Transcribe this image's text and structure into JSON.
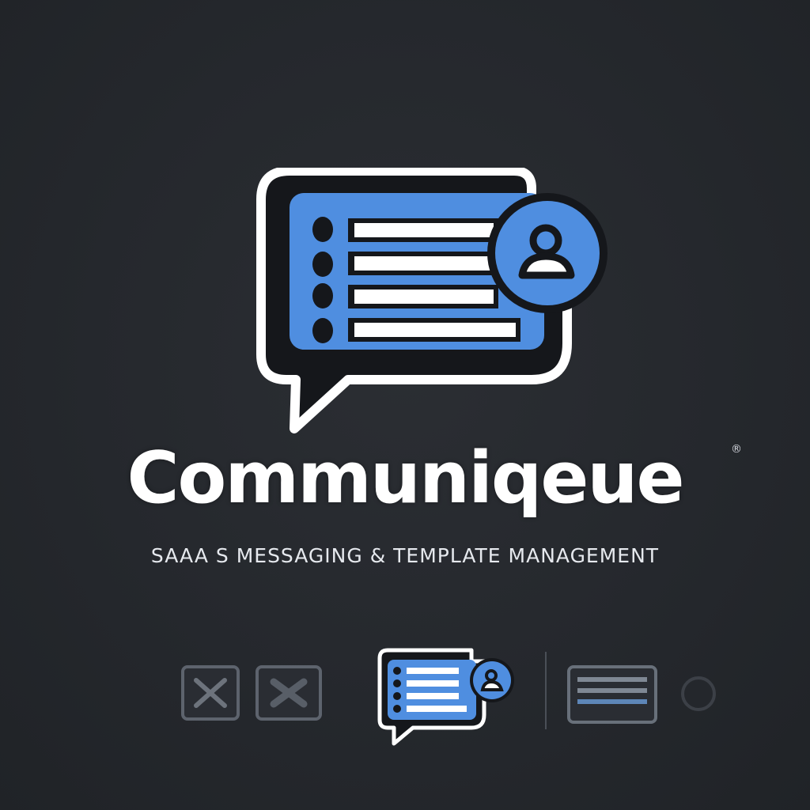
{
  "brand": {
    "name": "Communiqeue",
    "registered_mark": "®",
    "tagline": "SAAA S  MESSAGING & TEMPLATE MANAGEMENT"
  },
  "icons": {
    "main_logo": "chat-template-user-icon",
    "row": [
      "close-x-icon",
      "close-x-icon",
      "chat-template-user-icon",
      "divider",
      "template-list-icon",
      "circle-icon"
    ]
  },
  "colors": {
    "background": "#25282d",
    "accent_blue": "#4f8ee0",
    "white": "#ffffff",
    "dark_ink": "#15171b"
  }
}
